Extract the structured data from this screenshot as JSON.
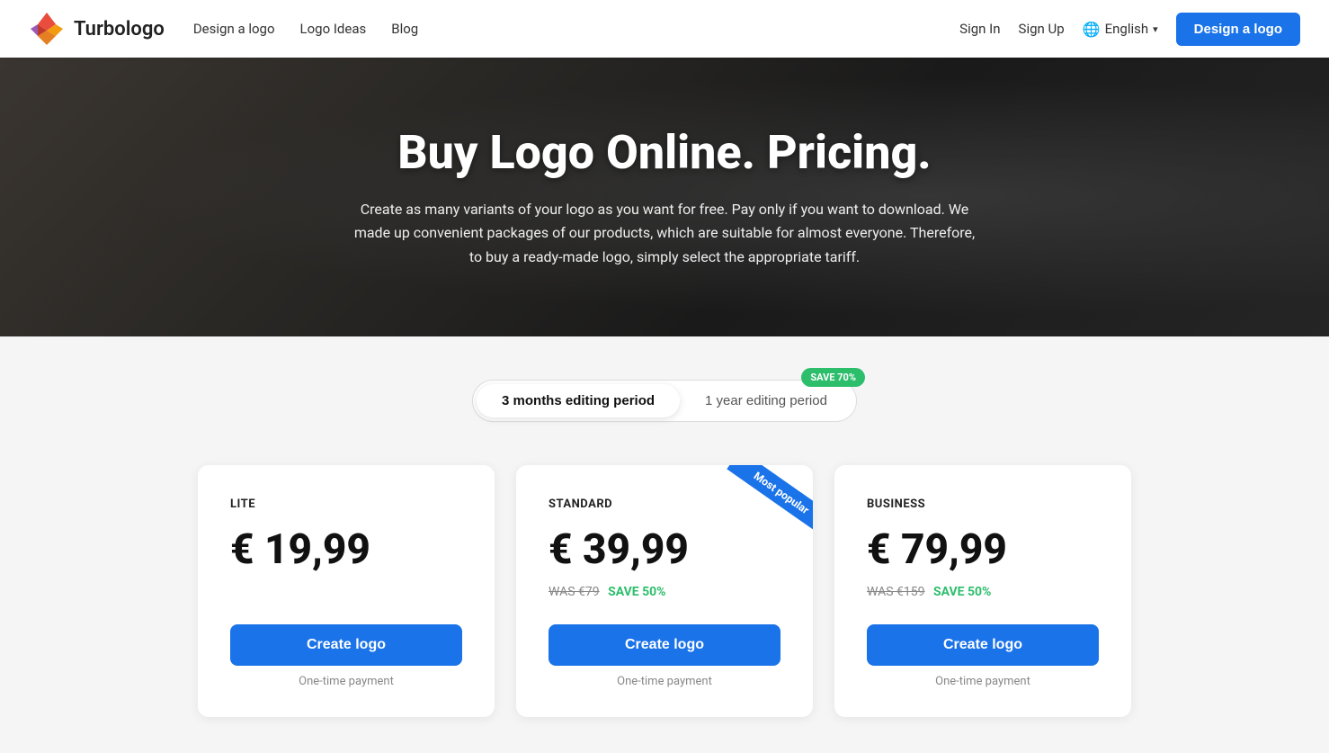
{
  "brand": {
    "name": "Turbologo"
  },
  "navbar": {
    "links": [
      {
        "label": "Design a logo",
        "href": "#"
      },
      {
        "label": "Logo Ideas",
        "href": "#"
      },
      {
        "label": "Blog",
        "href": "#"
      }
    ],
    "sign_in": "Sign In",
    "sign_up": "Sign Up",
    "language": "English",
    "cta": "Design a logo"
  },
  "hero": {
    "title": "Buy Logo Online. Pricing.",
    "subtitle": "Create as many variants of your logo as you want for free. Pay only if you want to download. We made up convenient packages of our products, which are suitable for almost everyone. Therefore, to buy a ready-made logo, simply select the appropriate tariff."
  },
  "pricing": {
    "toggle": {
      "option1": "3 months editing period",
      "option2": "1 year editing period",
      "save_badge": "SAVE 70%"
    },
    "cards": [
      {
        "tier": "LITE",
        "price": "€ 19,99",
        "was": null,
        "save": null,
        "cta": "Create logo",
        "payment_note": "One-time payment",
        "popular": false
      },
      {
        "tier": "STANDARD",
        "price": "€ 39,99",
        "was": "WAS €79",
        "save": "SAVE 50%",
        "cta": "Create logo",
        "payment_note": "One-time payment",
        "popular": true,
        "popular_label": "Most popular"
      },
      {
        "tier": "BUSINESS",
        "price": "€ 79,99",
        "was": "WAS €159",
        "save": "SAVE 50%",
        "cta": "Create logo",
        "payment_note": "One-time payment",
        "popular": false
      }
    ]
  }
}
